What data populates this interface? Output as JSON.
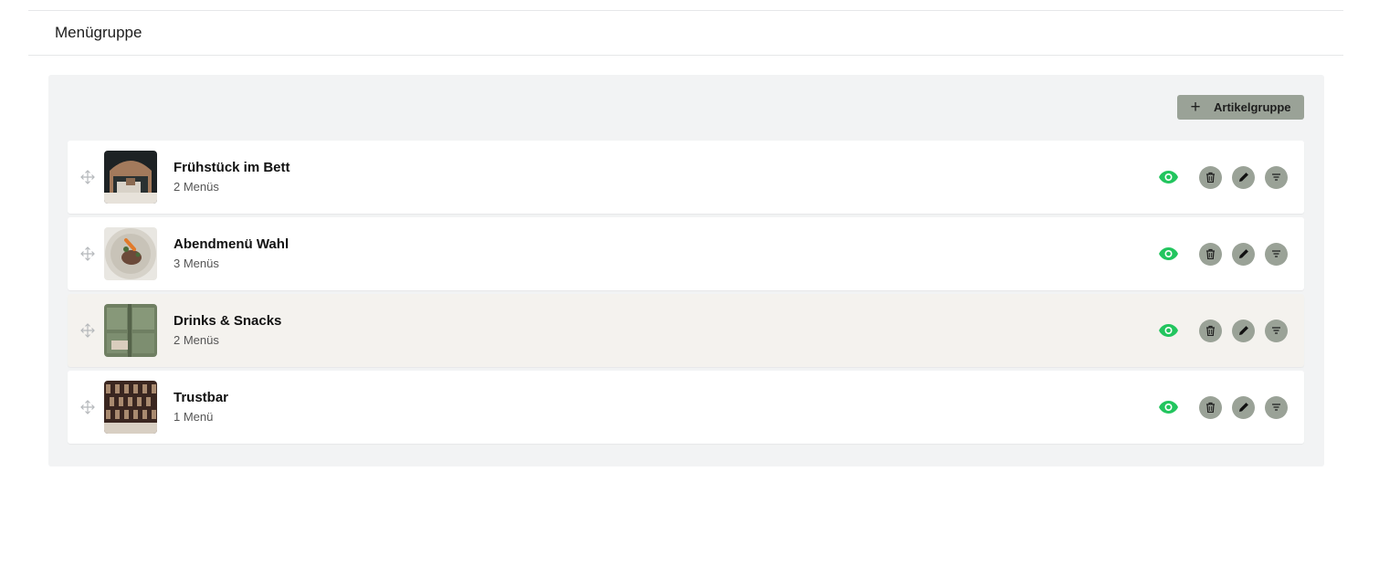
{
  "header": {
    "title": "Menügruppe"
  },
  "toolbar": {
    "add_label": "Artikelgruppe"
  },
  "colors": {
    "accent": "#9aa297",
    "visible_green": "#22c55e",
    "highlight_row": "#f4f2ee"
  },
  "groups": [
    {
      "name": "Frühstück im Bett",
      "count": "2 Menüs",
      "image": "breakfast-room-photo"
    },
    {
      "name": "Abendmenü Wahl",
      "count": "3 Menüs",
      "image": "plated-dish-photo"
    },
    {
      "name": "Drinks & Snacks",
      "count": "2 Menüs",
      "image": "green-tiles-photo"
    },
    {
      "name": "Trustbar",
      "count": "1 Menü",
      "image": "wine-rack-photo"
    }
  ]
}
